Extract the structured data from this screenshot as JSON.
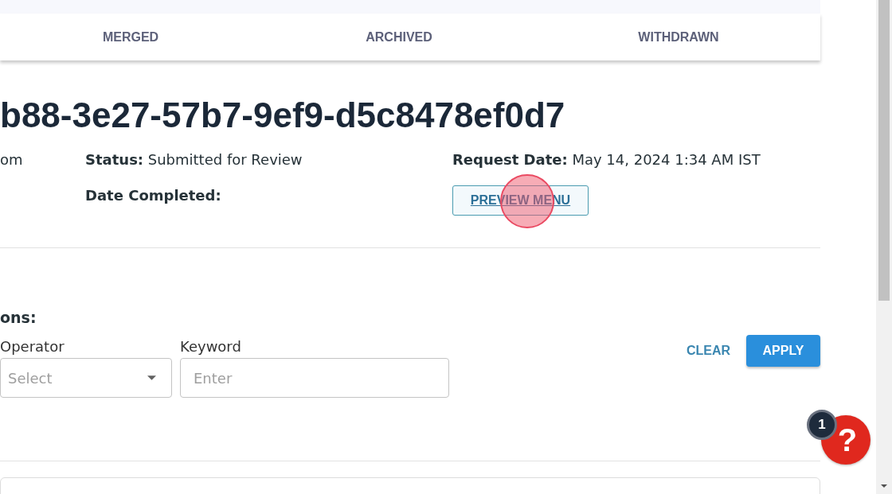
{
  "tabs": [
    {
      "label": "MERGED",
      "selected": false
    },
    {
      "label": "ARCHIVED",
      "selected": false
    },
    {
      "label": "WITHDRAWN",
      "selected": false
    }
  ],
  "request": {
    "title": "b88-3e27-57b7-9ef9-d5c8478ef0d7",
    "email_fragment": "om",
    "status": {
      "label": "Status:",
      "value": "Submitted for Review"
    },
    "request_date": {
      "label": "Request Date:",
      "value": "May 14, 2024 1:34 AM IST"
    },
    "date_completed": {
      "label": "Date Completed:"
    },
    "preview_button": "PREVIEW MENU"
  },
  "conditions": {
    "heading": "ons:",
    "operator": {
      "label": "Operator",
      "placeholder": "Select"
    },
    "keyword": {
      "label": "Keyword",
      "placeholder": "Enter"
    }
  },
  "actions": [
    {
      "label": "CLEAR",
      "kind": "text"
    },
    {
      "label": "APPLY",
      "kind": "primary"
    }
  ],
  "help": {
    "symbol": "?",
    "badge": "1"
  }
}
